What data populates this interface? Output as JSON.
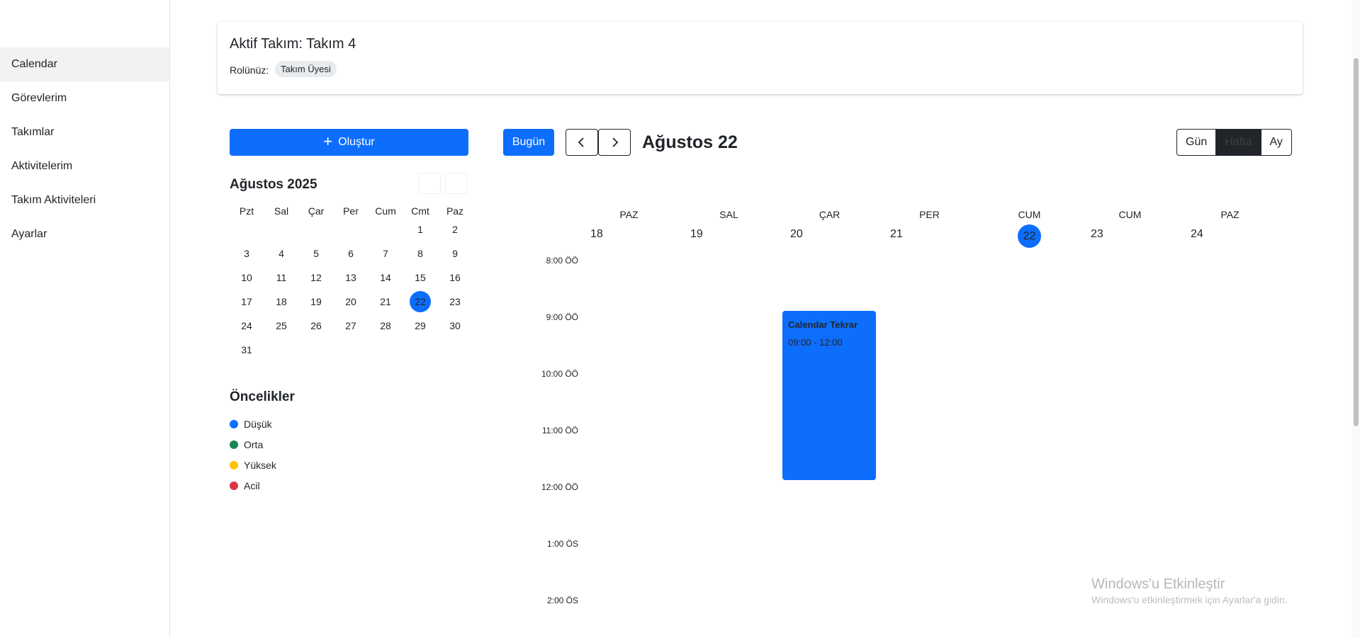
{
  "sidebar": {
    "items": [
      {
        "label": "Calendar"
      },
      {
        "label": "Görevlerim"
      },
      {
        "label": "Takımlar"
      },
      {
        "label": "Aktivitelerim"
      },
      {
        "label": "Takım Aktiviteleri"
      },
      {
        "label": "Ayarlar"
      }
    ]
  },
  "team": {
    "title": "Aktif Takım: Takım 4",
    "role_label": "Rolünüz:",
    "role_value": "Takım Üyesi"
  },
  "create_button": {
    "icon": "plus-icon",
    "label": "Oluştur"
  },
  "mini_calendar": {
    "title": "Ağustos 2025",
    "weekdays": [
      "Pzt",
      "Sal",
      "Çar",
      "Per",
      "Cum",
      "Cmt",
      "Paz"
    ],
    "weeks": [
      [
        "",
        "",
        "",
        "",
        "",
        "1",
        "2"
      ],
      [
        "3",
        "4",
        "5",
        "6",
        "7",
        "8",
        "9"
      ],
      [
        "10",
        "11",
        "12",
        "13",
        "14",
        "15",
        "16"
      ],
      [
        "17",
        "18",
        "19",
        "20",
        "21",
        "22",
        "23"
      ],
      [
        "24",
        "25",
        "26",
        "27",
        "28",
        "29",
        "30"
      ],
      [
        "31",
        "",
        "",
        "",
        "",
        "",
        ""
      ]
    ],
    "selected": "22"
  },
  "priorities": {
    "title": "Öncelikler",
    "items": [
      {
        "label": "Düşük",
        "color": "#0d6efd"
      },
      {
        "label": "Orta",
        "color": "#198754"
      },
      {
        "label": "Yüksek",
        "color": "#ffc107"
      },
      {
        "label": "Acil",
        "color": "#dc3545"
      }
    ]
  },
  "toolbar": {
    "today_label": "Bugün",
    "prev_icon": "chevron-left-icon",
    "next_icon": "chevron-right-icon",
    "title": "Ağustos 22",
    "views": [
      "Gün",
      "Hafta",
      "Ay"
    ],
    "active_view": "Hafta"
  },
  "week": {
    "day_names": [
      "PAZ",
      "SAL",
      "ÇAR",
      "PER",
      "CUM",
      "CUM",
      "PAZ"
    ],
    "day_numbers": [
      "18",
      "19",
      "20",
      "21",
      "22",
      "23",
      "24"
    ],
    "today": "22",
    "times": [
      "8:00 ÖÖ",
      "9:00 ÖÖ",
      "10:00 ÖÖ",
      "11:00 ÖÖ",
      "12:00 ÖÖ",
      "1:00 ÖS",
      "2:00 ÖS"
    ]
  },
  "event": {
    "title": "Calendar Tekrar",
    "time": "09:00 - 12:00",
    "color": "#0d6efd"
  },
  "watermark": {
    "title": "Windows'u Etkinleştir",
    "subtitle": "Windows'u etkinleştirmek için Ayarlar'a gidin."
  }
}
